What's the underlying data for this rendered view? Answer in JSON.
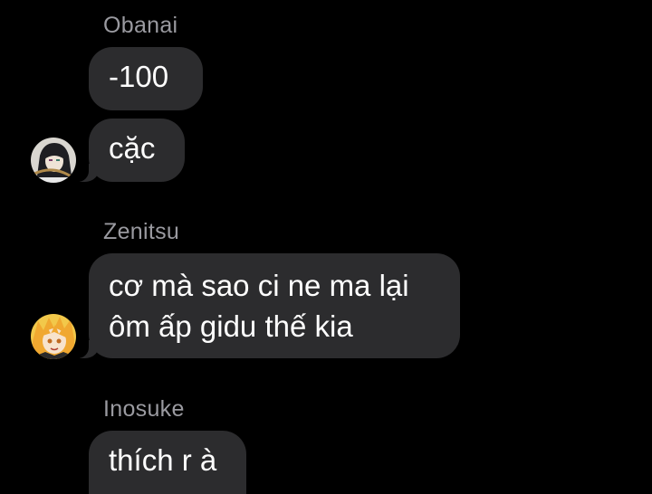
{
  "groups": [
    {
      "sender": "Obanai",
      "messages": [
        "-100",
        "cặc"
      ]
    },
    {
      "sender": "Zenitsu",
      "messages": [
        "cơ mà sao ci ne ma lại",
        "ôm ấp gidu thế kia"
      ]
    },
    {
      "sender": "Inosuke",
      "messages": [
        "thích r à"
      ]
    }
  ],
  "colors": {
    "background": "#000000",
    "bubble": "#2c2c2e",
    "sender_name": "#9a9aa0",
    "message_text": "#ffffff"
  },
  "avatars": {
    "obanai": "obanai-avatar",
    "zenitsu": "zenitsu-avatar"
  }
}
